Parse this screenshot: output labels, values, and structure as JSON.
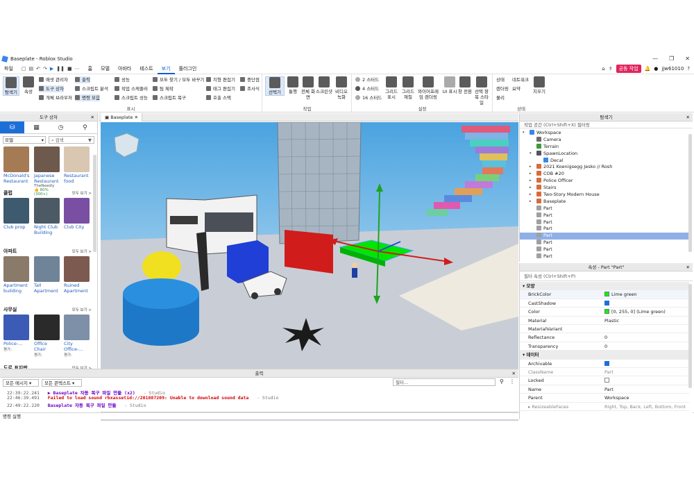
{
  "window": {
    "title": "Baseplate - Roblox Studio"
  },
  "menu": {
    "items": [
      "파일",
      "홈",
      "모델",
      "아바타",
      "테스트",
      "보기",
      "플러그인"
    ],
    "active": "보기",
    "team_button": "공동 작업",
    "username": "jjw61010"
  },
  "ribbon": {
    "left_buttons": {
      "explorer": "탐색기",
      "properties": "속성"
    },
    "col1": {
      "asset_manager": "애셋 관리자",
      "toolbox": "도구 상자",
      "object_browser": "개체 브라우저"
    },
    "col2": {
      "output": "출력",
      "script_analysis": "스크립트 분석",
      "command_bar": "명령 모음"
    },
    "col3": {
      "performance": "성능",
      "task_scheduler": "작업 스케줄러",
      "script_performance": "스크립트 성능"
    },
    "col4": {
      "find_replace": "모두 찾기 / 모두 바꾸기",
      "team_create": "팀 제작",
      "script_recovery": "스크립트 복구"
    },
    "col5": {
      "terrain_editor": "지형 편집기",
      "tag_editor": "태그 편집기",
      "call_stack": "호출 스택"
    },
    "col6": {
      "breakpoints": "중단점",
      "watch": "조사식"
    },
    "show_group_label": "표시",
    "actions": {
      "select": "선택기",
      "tour": "통행",
      "full_screen": "전체 화면",
      "screenshot": "스크린샷",
      "video": "비디오 녹화"
    },
    "actions_group_label": "작업",
    "studs": [
      "2 스터드",
      "4 스터드",
      "16 스터드"
    ],
    "settings": {
      "grid": "그리드 표시",
      "grid_material": "그리드 재질",
      "wireframe": "와이어프레임 렌더링",
      "ui_show": "UI 표시",
      "window_switch": "창 전환",
      "selection_style": "선택 항목 스타일"
    },
    "settings_group_label": "설정",
    "state": {
      "state": "상태",
      "render": "렌더링",
      "physics": "물리",
      "network": "네트워크",
      "summary": "요약",
      "clear": "지우기"
    },
    "state_group_label": "상태"
  },
  "toolbox": {
    "header": "도구 상자",
    "category": "모델",
    "search_placeholder": "검색",
    "top_row": [
      {
        "label": "McDonald's Restaurant",
        "color": "#a57b55"
      },
      {
        "label": "Japanese Restaurant",
        "sub": "TheNeedly",
        "rating": "80% (300+)",
        "color": "#6d5a4c"
      },
      {
        "label": "Restaurant food",
        "color": "#d9c7b2"
      }
    ],
    "sections": [
      {
        "title": "클럽",
        "see_all": "모두 보기 >",
        "items": [
          {
            "label": "Club prop",
            "color": "#3e5a6e"
          },
          {
            "label": "Night Club Building",
            "color": "#4c5a66"
          },
          {
            "label": "Club City",
            "color": "#7a4fa3"
          }
        ]
      },
      {
        "title": "아파트",
        "see_all": "모두 보기 >",
        "items": [
          {
            "label": "Apartment building",
            "color": "#8a7a6a"
          },
          {
            "label": "Tall Apartment",
            "color": "#6f8499"
          },
          {
            "label": "Ruined Apartment",
            "color": "#7d5a4f"
          }
        ]
      },
      {
        "title": "사무실",
        "see_all": "모두 보기 >",
        "items": [
          {
            "label": "Police-...",
            "sub": "평가:",
            "color": "#3b5bb5"
          },
          {
            "label": "Office Chair",
            "sub": "평가:",
            "color": "#2a2a2a"
          },
          {
            "label": "City Office-...",
            "sub": "평가:",
            "color": "#7e8fa8"
          }
        ]
      },
      {
        "title": "도로 표지판",
        "see_all": "모두 보기 >",
        "items": []
      }
    ]
  },
  "viewport": {
    "tab": "Baseplate"
  },
  "output": {
    "header": "출력",
    "filter_messages": "모든 메시지",
    "filter_context": "모든 콘텍스트",
    "filter_placeholder": "필터...",
    "lines": [
      {
        "time": "22:39:22.241",
        "text": "▶ Baseplate 자동 복구 파일 만듦 (x2)",
        "source": "-  Studio",
        "kind": "msg"
      },
      {
        "time": "22:46:39.491",
        "text": "Failed to load sound rbxassetid://201887209: Unable to download sound data",
        "source": "-  Studio",
        "kind": "err"
      },
      {
        "time": "22:49:22.220",
        "text": "Baseplate 자동 복구 파일 만듦",
        "source": "-  Studio",
        "kind": "msg"
      }
    ]
  },
  "command_bar": {
    "label": "명령 실행"
  },
  "explorer": {
    "header": "탐색기",
    "filter_placeholder": "작업 공간 (Ctrl+Shift+X) 필터링",
    "items": [
      {
        "label": "Workspace",
        "indent": 0,
        "exp": "▾",
        "color": "#3a86e8"
      },
      {
        "label": "Camera",
        "indent": 1,
        "exp": "",
        "color": "#6b6b6b"
      },
      {
        "label": "Terrain",
        "indent": 1,
        "exp": "",
        "color": "#3a9b3a"
      },
      {
        "label": "SpawnLocation",
        "indent": 1,
        "exp": "▾",
        "color": "#555555"
      },
      {
        "label": "Decal",
        "indent": 2,
        "exp": "",
        "color": "#3a86e8"
      },
      {
        "label": "2021 Koenigsegg Jesko // Rosh",
        "indent": 1,
        "exp": "▸",
        "color": "#d96b3a"
      },
      {
        "label": "COB #20",
        "indent": 1,
        "exp": "▸",
        "color": "#d96b3a"
      },
      {
        "label": "Police Officer",
        "indent": 1,
        "exp": "▸",
        "color": "#d96b3a"
      },
      {
        "label": "Stairs",
        "indent": 1,
        "exp": "▸",
        "color": "#d96b3a"
      },
      {
        "label": "Two-Story Modern House",
        "indent": 1,
        "exp": "▸",
        "color": "#d96b3a"
      },
      {
        "label": "Baseplate",
        "indent": 1,
        "exp": "▸",
        "color": "#d96b3a"
      },
      {
        "label": "Part",
        "indent": 1,
        "exp": "",
        "color": "#a0a0a0"
      },
      {
        "label": "Part",
        "indent": 1,
        "exp": "",
        "color": "#a0a0a0"
      },
      {
        "label": "Part",
        "indent": 1,
        "exp": "",
        "color": "#a0a0a0"
      },
      {
        "label": "Part",
        "indent": 1,
        "exp": "",
        "color": "#a0a0a0"
      },
      {
        "label": "Part",
        "indent": 1,
        "exp": "",
        "color": "#a0a0a0",
        "selected": true
      },
      {
        "label": "Part",
        "indent": 1,
        "exp": "",
        "color": "#a0a0a0"
      },
      {
        "label": "Part",
        "indent": 1,
        "exp": "",
        "color": "#a0a0a0"
      },
      {
        "label": "Part",
        "indent": 1,
        "exp": "",
        "color": "#a0a0a0"
      }
    ]
  },
  "properties": {
    "header": "속성 - Part \"Part\"",
    "filter_placeholder": "필터 속성 (Ctrl+Shift+P)",
    "sections": [
      {
        "title": "모양",
        "rows": [
          {
            "name": "BrickColor",
            "value": "Lime green",
            "swatch": "#00ff00",
            "highlight": true
          },
          {
            "name": "CastShadow",
            "check": true
          },
          {
            "name": "Color",
            "value": "[0, 255, 0] (Lime green)",
            "swatch": "#00ff00"
          },
          {
            "name": "Material",
            "value": "Plastic"
          },
          {
            "name": "MaterialVariant",
            "value": ""
          },
          {
            "name": "Reflectance",
            "value": "0"
          },
          {
            "name": "Transparency",
            "value": "0"
          }
        ]
      },
      {
        "title": "데이터",
        "rows": [
          {
            "name": "Archivable",
            "check": true
          },
          {
            "name": "ClassName",
            "value": "Part",
            "muted": true
          },
          {
            "name": "Locked",
            "check": false
          },
          {
            "name": "Name",
            "value": "Part"
          },
          {
            "name": "Parent",
            "value": "Workspace"
          },
          {
            "name": "ResizeableFaces",
            "value": "Right, Top, Back, Left, Bottom, Front",
            "muted": true,
            "exp": "▸"
          }
        ]
      }
    ]
  }
}
